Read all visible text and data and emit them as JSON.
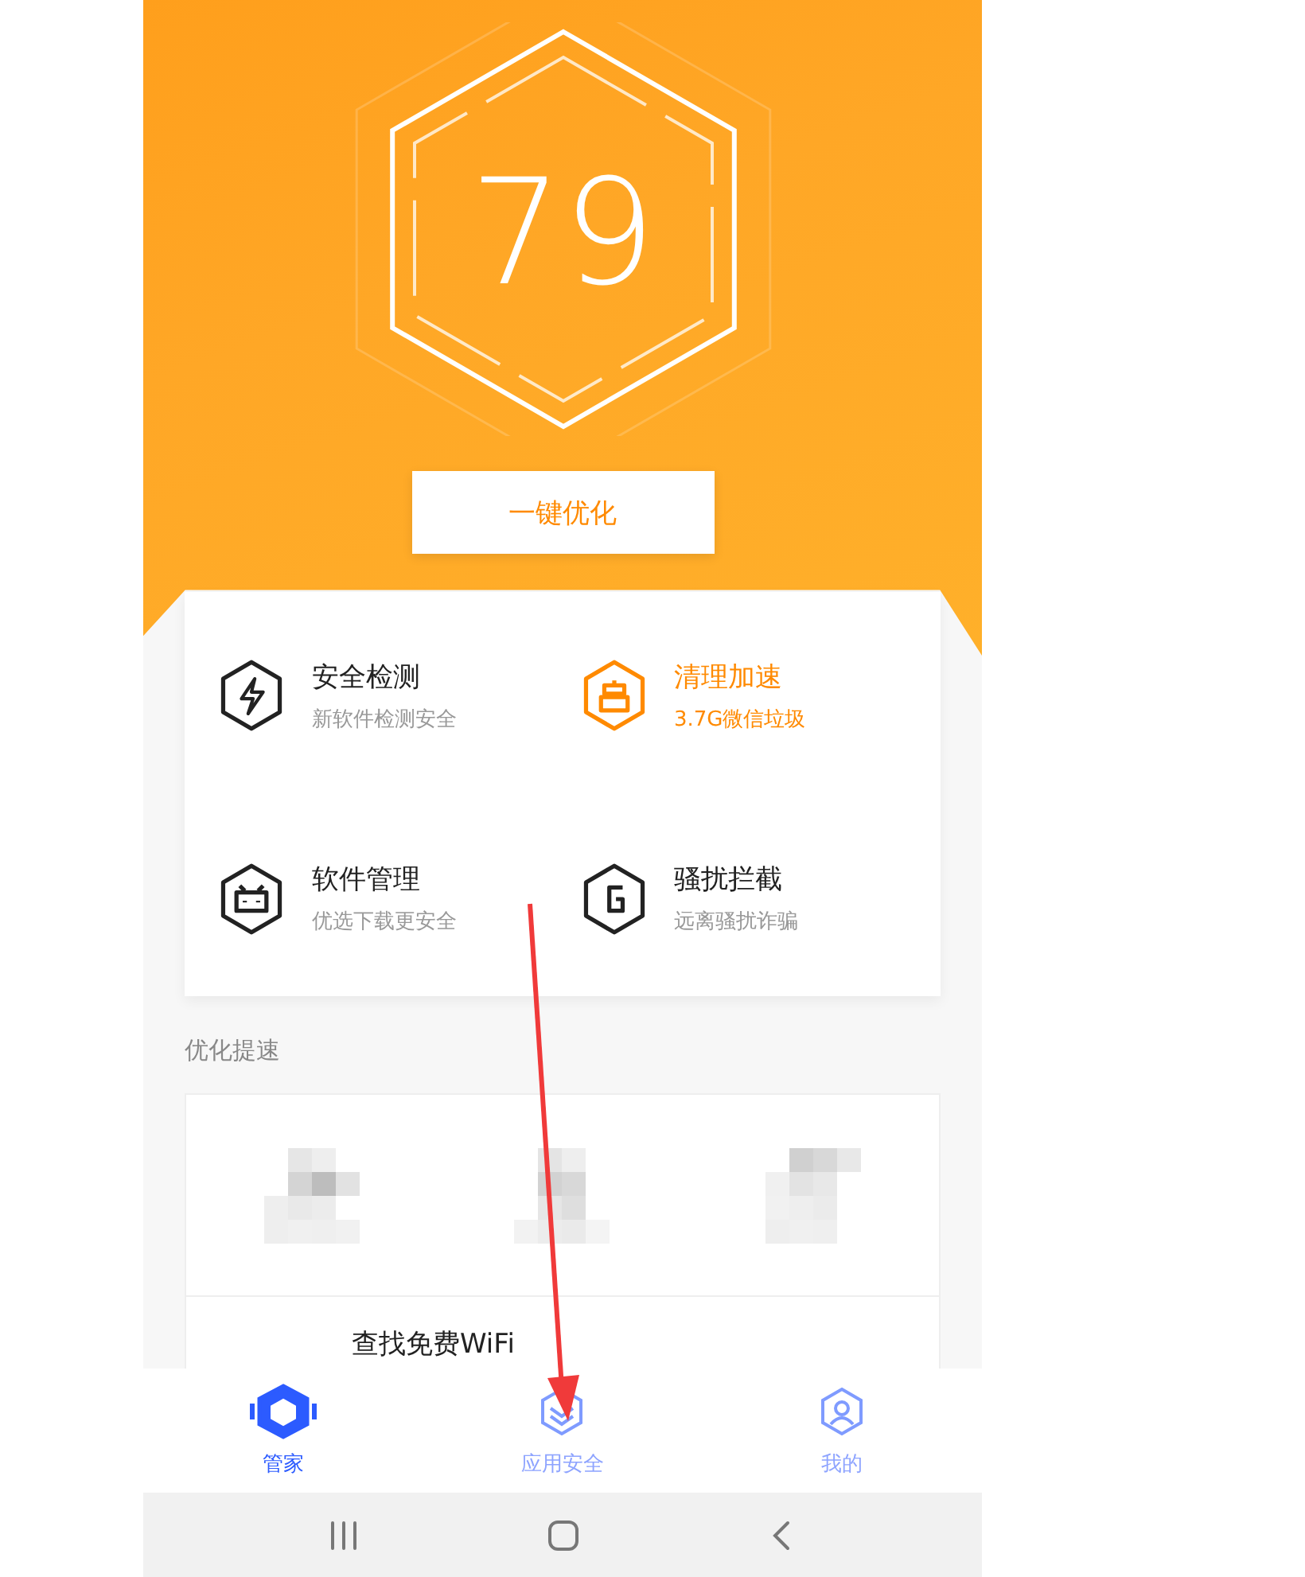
{
  "score": {
    "value": "79"
  },
  "optimize_button": {
    "label": "一键优化"
  },
  "features": [
    {
      "title": "安全检测",
      "subtitle": "新软件检测安全",
      "highlighted": false
    },
    {
      "title": "清理加速",
      "subtitle": "3.7G微信垃圾",
      "highlighted": true
    },
    {
      "title": "软件管理",
      "subtitle": "优选下载更安全",
      "highlighted": false
    },
    {
      "title": "骚扰拦截",
      "subtitle": "远离骚扰诈骗",
      "highlighted": false
    }
  ],
  "section": {
    "title": "优化提速"
  },
  "wifi_item": {
    "title": "查找免费WiFi"
  },
  "tabs": [
    {
      "label": "管家",
      "selected": true
    },
    {
      "label": "应用安全",
      "selected": false
    },
    {
      "label": "我的",
      "selected": false
    }
  ]
}
